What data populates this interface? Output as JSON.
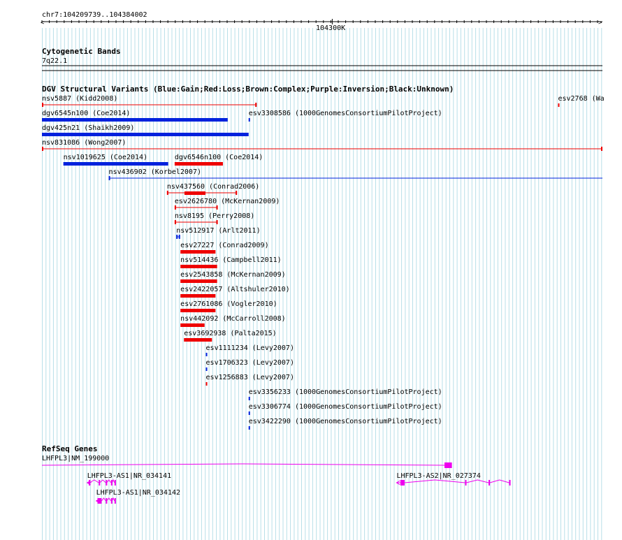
{
  "locus": "chr7:104209739..104384002",
  "ruler": {
    "tick_label": "104300K",
    "start": 104209739,
    "end": 104384002
  },
  "cytoband": {
    "title": "Cytogenetic Bands",
    "band": "7q22.1"
  },
  "dgv": {
    "title": "DGV Structural Variants (Blue:Gain;Red:Loss;Brown:Complex;Purple:Inversion;Black:Unknown)",
    "colors": {
      "gain": "#0022dd",
      "loss": "#ee0000"
    },
    "features": [
      {
        "name": "nsv5887 (Kidd2008)",
        "type": "loss",
        "style": "line-capped",
        "start": 104209739,
        "end": 104276500
      },
      {
        "name": "esv2768 (Wa",
        "type": "loss",
        "style": "tick",
        "start": 104370200,
        "end": 104370500
      },
      {
        "name": "dgv6545n100 (Coe2014)",
        "type": "gain",
        "style": "thick",
        "start": 104209739,
        "end": 104267500
      },
      {
        "name": "esv3308586 (1000GenomesConsortiumPilotProject)",
        "type": "gain",
        "style": "tick",
        "start": 104274000,
        "end": 104274500
      },
      {
        "name": "dgv425n21 (Shaikh2009)",
        "type": "gain",
        "style": "thick",
        "start": 104209739,
        "end": 104274000
      },
      {
        "name": "nsv831086 (Wong2007)",
        "type": "loss",
        "style": "line-capped",
        "start": 104209739,
        "end": 104384002
      },
      {
        "name": "nsv1019625 (Coe2014)",
        "type": "gain",
        "style": "thick",
        "start": 104216400,
        "end": 104249000
      },
      {
        "name": "dgv6546n100 (Coe2014)",
        "type": "loss",
        "style": "thick",
        "start": 104251000,
        "end": 104266000
      },
      {
        "name": "nsv436902 (Korbel2007)",
        "type": "gain",
        "style": "line-open",
        "start": 104230500,
        "end": 104384002
      },
      {
        "name": "nsv437560 (Conrad2006)",
        "type": "loss",
        "style": "line-core",
        "start": 104248600,
        "end": 104270400
      },
      {
        "name": "esv2626780 (McKernan2009)",
        "type": "loss",
        "style": "line-capped",
        "start": 104251000,
        "end": 104264400
      },
      {
        "name": "nsv8195 (Perry2008)",
        "type": "loss",
        "style": "line-capped",
        "start": 104251000,
        "end": 104264400
      },
      {
        "name": "nsv512917 (Arlt2011)",
        "type": "gain",
        "style": "line-capped",
        "start": 104251500,
        "end": 104252700
      },
      {
        "name": "esv27227 (Conrad2009)",
        "type": "loss",
        "style": "thick",
        "start": 104252800,
        "end": 104263700
      },
      {
        "name": "nsv514436 (Campbell2011)",
        "type": "loss",
        "style": "thick",
        "start": 104252800,
        "end": 104264200
      },
      {
        "name": "esv2543858 (McKernan2009)",
        "type": "loss",
        "style": "thick",
        "start": 104252800,
        "end": 104264200
      },
      {
        "name": "esv2422057 (Altshuler2010)",
        "type": "loss",
        "style": "thick",
        "start": 104252800,
        "end": 104263700
      },
      {
        "name": "esv2761086 (Vogler2010)",
        "type": "loss",
        "style": "thick",
        "start": 104252800,
        "end": 104263700
      },
      {
        "name": "nsv442092 (McCarroll2008)",
        "type": "loss",
        "style": "thick",
        "start": 104252800,
        "end": 104260300
      },
      {
        "name": "esv3692938 (Palta2015)",
        "type": "loss",
        "style": "thick",
        "start": 104253900,
        "end": 104262600
      },
      {
        "name": "esv1111234 (Levy2007)",
        "type": "gain",
        "style": "tick",
        "start": 104260700,
        "end": 104261100
      },
      {
        "name": "esv1706323 (Levy2007)",
        "type": "gain",
        "style": "tick",
        "start": 104260700,
        "end": 104261100
      },
      {
        "name": "esv1256883 (Levy2007)",
        "type": "loss",
        "style": "tick",
        "start": 104260700,
        "end": 104261100
      },
      {
        "name": "esv3356233 (1000GenomesConsortiumPilotProject)",
        "type": "gain",
        "style": "tick",
        "start": 104274000,
        "end": 104274500
      },
      {
        "name": "esv3306774 (1000GenomesConsortiumPilotProject)",
        "type": "gain",
        "style": "tick",
        "start": 104274000,
        "end": 104274500
      },
      {
        "name": "esv3422290 (1000GenomesConsortiumPilotProject)",
        "type": "gain",
        "style": "tick",
        "start": 104274000,
        "end": 104274500
      }
    ]
  },
  "refseq": {
    "title": "RefSeq Genes",
    "color": "#ee00ee",
    "genes": [
      {
        "label": "LHFPL3|NM_199000",
        "strand": "+",
        "start": 104209739,
        "end": 104336800,
        "exons": [
          [
            104334900,
            104337200
          ]
        ]
      },
      {
        "label": "LHFPL3-AS1|NR_034141",
        "strand": "-",
        "start": 104223800,
        "end": 104232800,
        "exons": [
          [
            104224300,
            104224600
          ],
          [
            104227400,
            104227700
          ],
          [
            104229600,
            104229900
          ],
          [
            104231200,
            104231500
          ],
          [
            104232300,
            104232700
          ]
        ]
      },
      {
        "label": "LHFPL3-AS1|NR_034142",
        "strand": "-",
        "start": 104226600,
        "end": 104232800,
        "exons": [
          [
            104227000,
            104228300
          ],
          [
            104229600,
            104229900
          ],
          [
            104231200,
            104231500
          ],
          [
            104232300,
            104232700
          ]
        ]
      },
      {
        "label": "LHFPL3-AS2|NR_027374",
        "strand": "-",
        "start": 104320000,
        "end": 104355400,
        "exons": [
          [
            104321200,
            104322500
          ],
          [
            104341300,
            104341700
          ],
          [
            104348600,
            104349000
          ],
          [
            104355000,
            104355400
          ]
        ]
      }
    ]
  }
}
